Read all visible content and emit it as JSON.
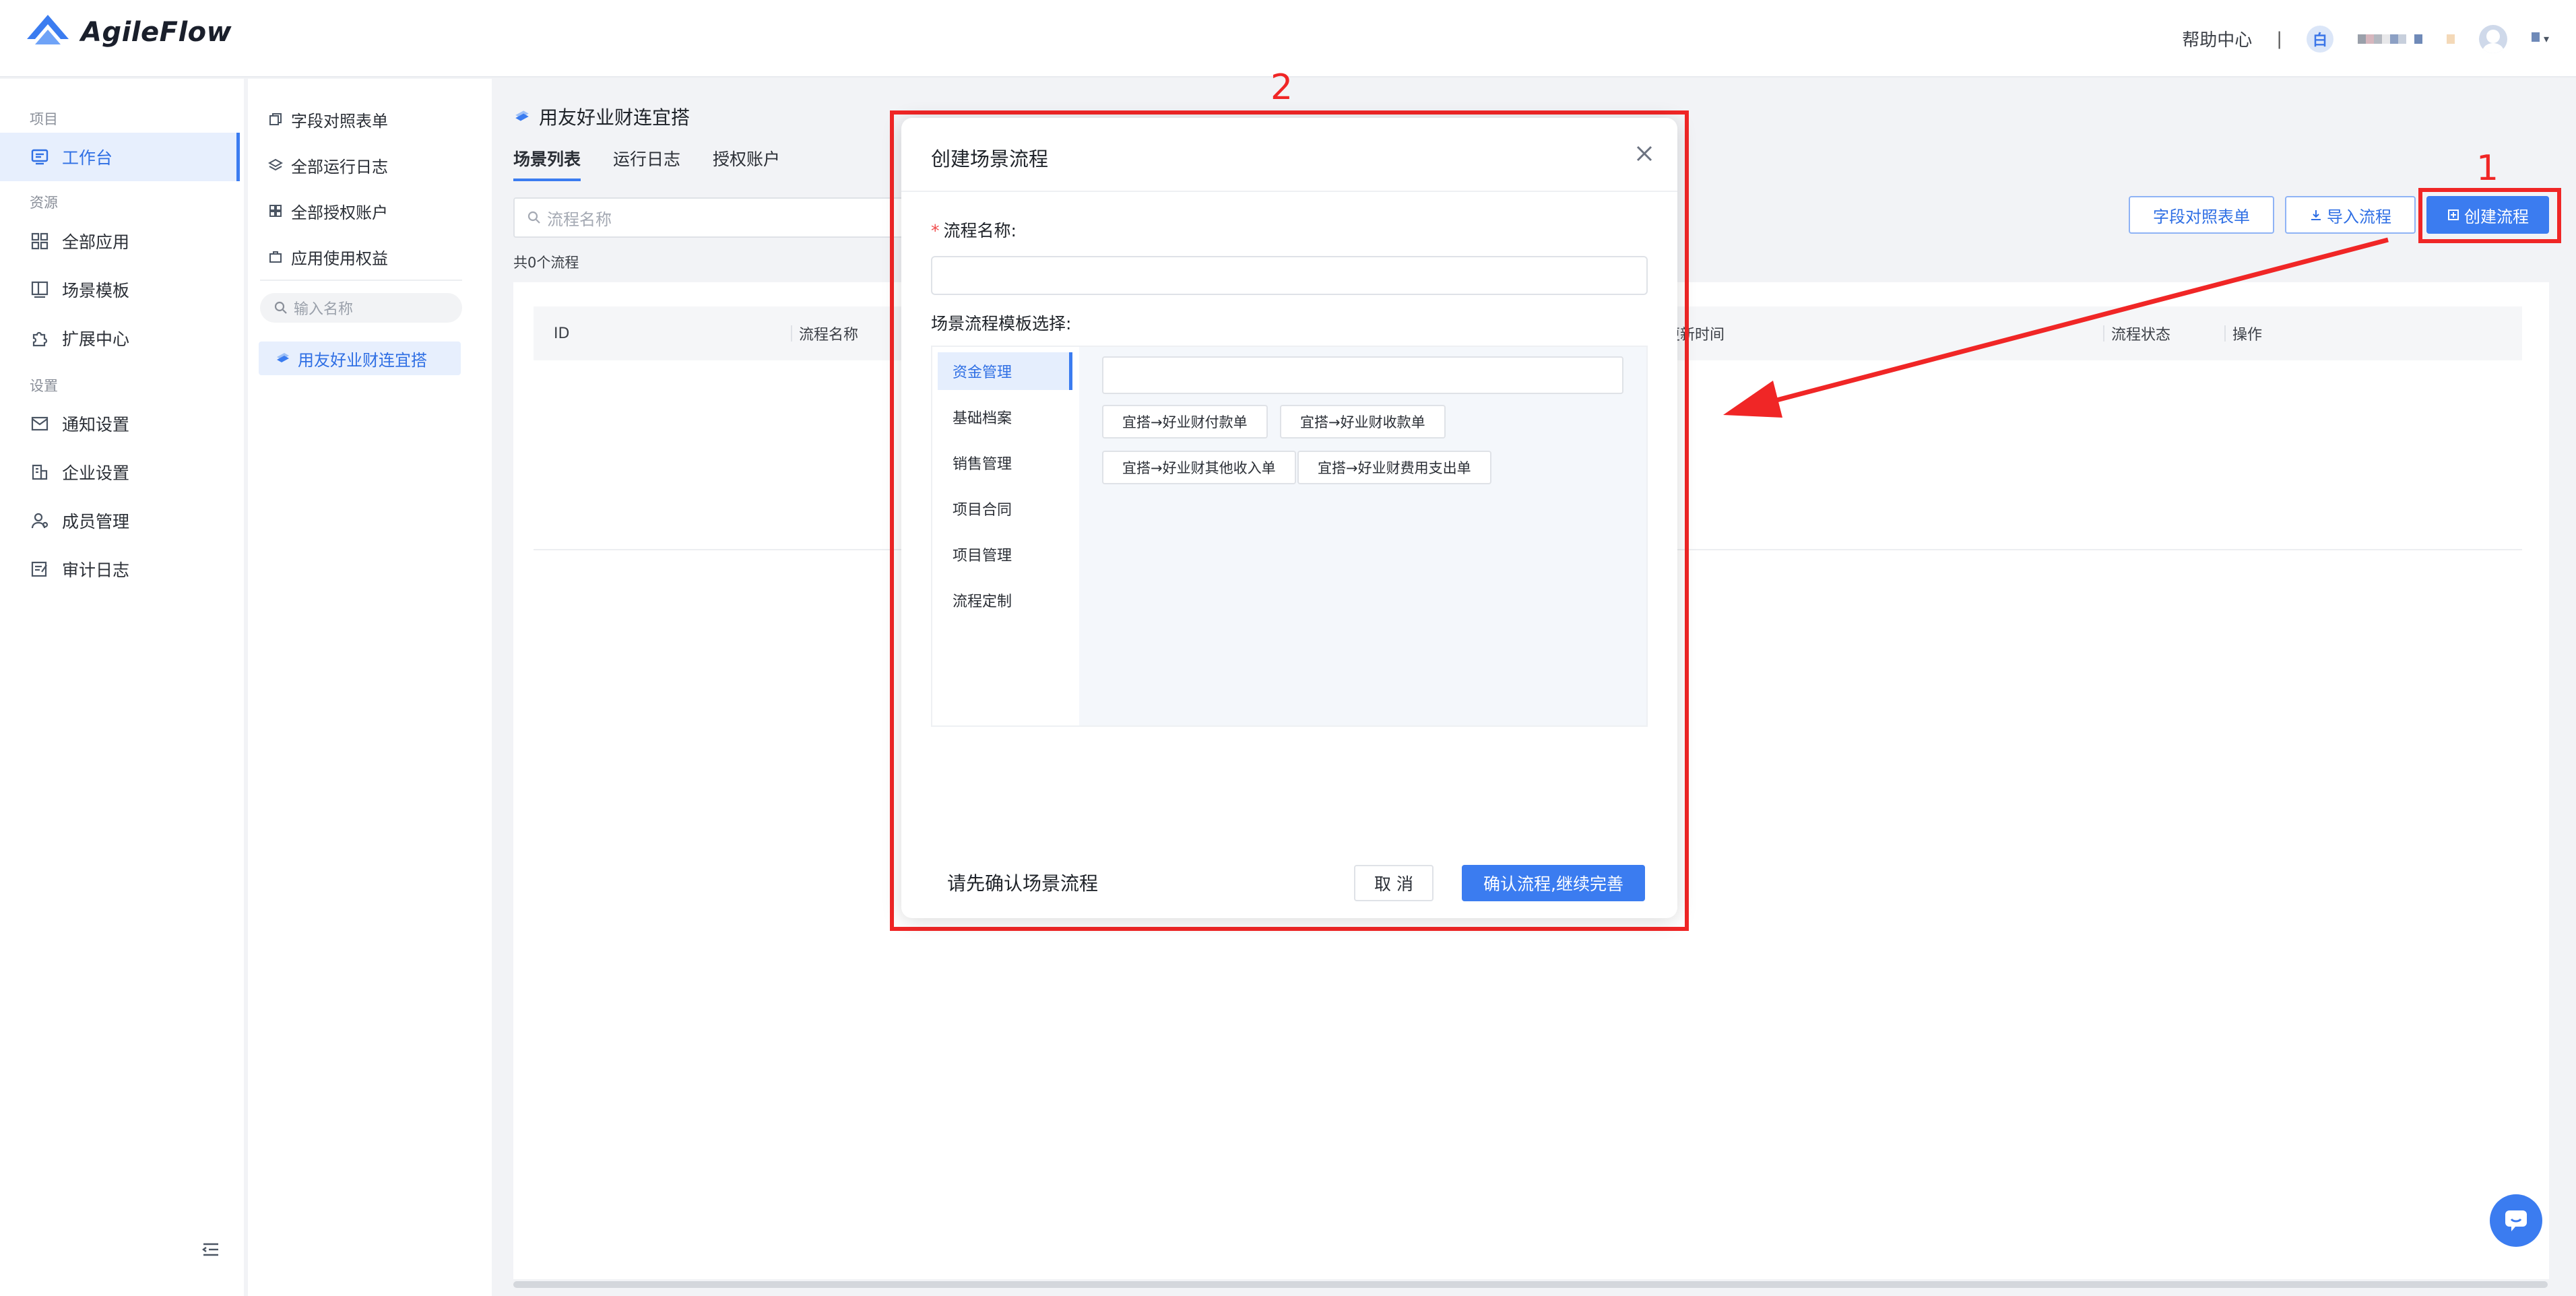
{
  "header": {
    "brand": "AgileFlow",
    "help_center": "帮助中心",
    "separator": "|",
    "org_badge": "白"
  },
  "sidebar": {
    "sections": [
      {
        "label": "项目"
      },
      {
        "label": "资源"
      },
      {
        "label": "设置"
      }
    ],
    "items": [
      {
        "label": "工作台",
        "icon": "workbench-icon"
      },
      {
        "label": "全部应用",
        "icon": "apps-icon"
      },
      {
        "label": "场景模板",
        "icon": "template-icon"
      },
      {
        "label": "扩展中心",
        "icon": "puzzle-icon"
      },
      {
        "label": "通知设置",
        "icon": "notification-icon"
      },
      {
        "label": "企业设置",
        "icon": "enterprise-icon"
      },
      {
        "label": "成员管理",
        "icon": "members-icon"
      },
      {
        "label": "审计日志",
        "icon": "audit-log-icon"
      }
    ]
  },
  "panel2": {
    "items": [
      {
        "label": "字段对照表单"
      },
      {
        "label": "全部运行日志"
      },
      {
        "label": "全部授权账户"
      },
      {
        "label": "应用使用权益"
      }
    ],
    "search_placeholder": "输入名称",
    "active_item": "用友好业财连宜搭"
  },
  "main": {
    "title": "用友好业财连宜搭",
    "tabs": [
      {
        "label": "场景列表"
      },
      {
        "label": "运行日志"
      },
      {
        "label": "授权账户"
      }
    ],
    "search_placeholder": "流程名称",
    "count_text": "共0个流程",
    "buttons": {
      "field_map": "字段对照表单",
      "import": "导入流程",
      "create": "创建流程"
    },
    "table_headers": [
      "ID",
      "流程名称",
      "更新时间",
      "流程状态",
      "操作"
    ]
  },
  "annotations": {
    "step1": "1",
    "step2": "2"
  },
  "modal": {
    "title": "创建场景流程",
    "name_label": "流程名称:",
    "name_required_mark": "*",
    "template_label": "场景流程模板选择:",
    "categories": [
      "资金管理",
      "基础档案",
      "销售管理",
      "项目合同",
      "项目管理",
      "流程定制"
    ],
    "templates": [
      "宜搭→好业财付款单",
      "宜搭→好业财收款单",
      "宜搭→好业财其他收入单",
      "宜搭→好业财费用支出单"
    ],
    "hint": "请先确认场景流程",
    "cancel": "取 消",
    "confirm": "确认流程,继续完善"
  },
  "colors": {
    "accent": "#3b7cf0",
    "annotation_red": "#f02626"
  }
}
